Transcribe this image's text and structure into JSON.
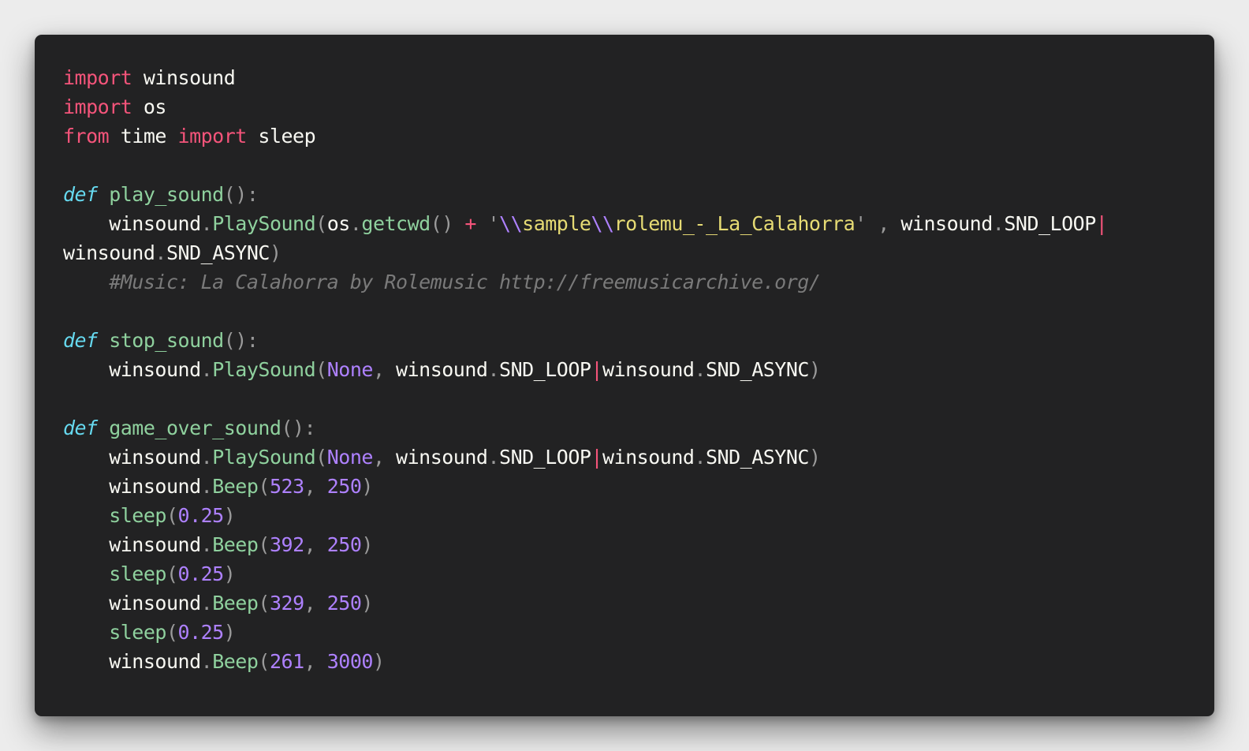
{
  "code": {
    "language": "python",
    "lines": [
      [
        {
          "t": "import",
          "c": "k"
        },
        {
          "t": " winsound",
          "c": "n"
        }
      ],
      [
        {
          "t": "import",
          "c": "k"
        },
        {
          "t": " os",
          "c": "n"
        }
      ],
      [
        {
          "t": "from",
          "c": "k"
        },
        {
          "t": " time ",
          "c": "n"
        },
        {
          "t": "import",
          "c": "k"
        },
        {
          "t": " sleep",
          "c": "n"
        }
      ],
      [],
      [
        {
          "t": "def",
          "c": "d"
        },
        {
          "t": " play_sound",
          "c": "f"
        },
        {
          "t": "():",
          "c": "p"
        }
      ],
      [
        {
          "t": "    winsound",
          "c": "n"
        },
        {
          "t": ".",
          "c": "p"
        },
        {
          "t": "PlaySound",
          "c": "f"
        },
        {
          "t": "(",
          "c": "p"
        },
        {
          "t": "os",
          "c": "n"
        },
        {
          "t": ".",
          "c": "p"
        },
        {
          "t": "getcwd",
          "c": "f"
        },
        {
          "t": "() ",
          "c": "p"
        },
        {
          "t": "+",
          "c": "k"
        },
        {
          "t": " '",
          "c": "p"
        },
        {
          "t": "\\\\",
          "c": "e"
        },
        {
          "t": "sample",
          "c": "s"
        },
        {
          "t": "\\\\",
          "c": "e"
        },
        {
          "t": "rolemu_-_La_Calahorra",
          "c": "s"
        },
        {
          "t": "'",
          "c": "p"
        },
        {
          "t": " , ",
          "c": "p"
        },
        {
          "t": "winsound",
          "c": "n"
        },
        {
          "t": ".",
          "c": "p"
        },
        {
          "t": "SND_LOOP",
          "c": "n"
        },
        {
          "t": "|",
          "c": "bar"
        }
      ],
      [
        {
          "t": "winsound",
          "c": "n"
        },
        {
          "t": ".",
          "c": "p"
        },
        {
          "t": "SND_ASYNC",
          "c": "n"
        },
        {
          "t": ")",
          "c": "p"
        }
      ],
      [
        {
          "t": "    #Music: La Calahorra by Rolemusic http://freemusicarchive.org/",
          "c": "c"
        }
      ],
      [],
      [
        {
          "t": "def",
          "c": "d"
        },
        {
          "t": " stop_sound",
          "c": "f"
        },
        {
          "t": "():",
          "c": "p"
        }
      ],
      [
        {
          "t": "    winsound",
          "c": "n"
        },
        {
          "t": ".",
          "c": "p"
        },
        {
          "t": "PlaySound",
          "c": "f"
        },
        {
          "t": "(",
          "c": "p"
        },
        {
          "t": "None",
          "c": "e"
        },
        {
          "t": ", ",
          "c": "p"
        },
        {
          "t": "winsound",
          "c": "n"
        },
        {
          "t": ".",
          "c": "p"
        },
        {
          "t": "SND_LOOP",
          "c": "n"
        },
        {
          "t": "|",
          "c": "bar"
        },
        {
          "t": "winsound",
          "c": "n"
        },
        {
          "t": ".",
          "c": "p"
        },
        {
          "t": "SND_ASYNC",
          "c": "n"
        },
        {
          "t": ")",
          "c": "p"
        }
      ],
      [],
      [
        {
          "t": "def",
          "c": "d"
        },
        {
          "t": " game_over_sound",
          "c": "f"
        },
        {
          "t": "():",
          "c": "p"
        }
      ],
      [
        {
          "t": "    winsound",
          "c": "n"
        },
        {
          "t": ".",
          "c": "p"
        },
        {
          "t": "PlaySound",
          "c": "f"
        },
        {
          "t": "(",
          "c": "p"
        },
        {
          "t": "None",
          "c": "e"
        },
        {
          "t": ", ",
          "c": "p"
        },
        {
          "t": "winsound",
          "c": "n"
        },
        {
          "t": ".",
          "c": "p"
        },
        {
          "t": "SND_LOOP",
          "c": "n"
        },
        {
          "t": "|",
          "c": "bar"
        },
        {
          "t": "winsound",
          "c": "n"
        },
        {
          "t": ".",
          "c": "p"
        },
        {
          "t": "SND_ASYNC",
          "c": "n"
        },
        {
          "t": ")",
          "c": "p"
        }
      ],
      [
        {
          "t": "    winsound",
          "c": "n"
        },
        {
          "t": ".",
          "c": "p"
        },
        {
          "t": "Beep",
          "c": "f"
        },
        {
          "t": "(",
          "c": "p"
        },
        {
          "t": "523",
          "c": "e"
        },
        {
          "t": ", ",
          "c": "p"
        },
        {
          "t": "250",
          "c": "e"
        },
        {
          "t": ")",
          "c": "p"
        }
      ],
      [
        {
          "t": "    sleep",
          "c": "f"
        },
        {
          "t": "(",
          "c": "p"
        },
        {
          "t": "0.25",
          "c": "e"
        },
        {
          "t": ")",
          "c": "p"
        }
      ],
      [
        {
          "t": "    winsound",
          "c": "n"
        },
        {
          "t": ".",
          "c": "p"
        },
        {
          "t": "Beep",
          "c": "f"
        },
        {
          "t": "(",
          "c": "p"
        },
        {
          "t": "392",
          "c": "e"
        },
        {
          "t": ", ",
          "c": "p"
        },
        {
          "t": "250",
          "c": "e"
        },
        {
          "t": ")",
          "c": "p"
        }
      ],
      [
        {
          "t": "    sleep",
          "c": "f"
        },
        {
          "t": "(",
          "c": "p"
        },
        {
          "t": "0.25",
          "c": "e"
        },
        {
          "t": ")",
          "c": "p"
        }
      ],
      [
        {
          "t": "    winsound",
          "c": "n"
        },
        {
          "t": ".",
          "c": "p"
        },
        {
          "t": "Beep",
          "c": "f"
        },
        {
          "t": "(",
          "c": "p"
        },
        {
          "t": "329",
          "c": "e"
        },
        {
          "t": ", ",
          "c": "p"
        },
        {
          "t": "250",
          "c": "e"
        },
        {
          "t": ")",
          "c": "p"
        }
      ],
      [
        {
          "t": "    sleep",
          "c": "f"
        },
        {
          "t": "(",
          "c": "p"
        },
        {
          "t": "0.25",
          "c": "e"
        },
        {
          "t": ")",
          "c": "p"
        }
      ],
      [
        {
          "t": "    winsound",
          "c": "n"
        },
        {
          "t": ".",
          "c": "p"
        },
        {
          "t": "Beep",
          "c": "f"
        },
        {
          "t": "(",
          "c": "p"
        },
        {
          "t": "261",
          "c": "e"
        },
        {
          "t": ", ",
          "c": "p"
        },
        {
          "t": "3000",
          "c": "e"
        },
        {
          "t": ")",
          "c": "p"
        }
      ]
    ]
  }
}
